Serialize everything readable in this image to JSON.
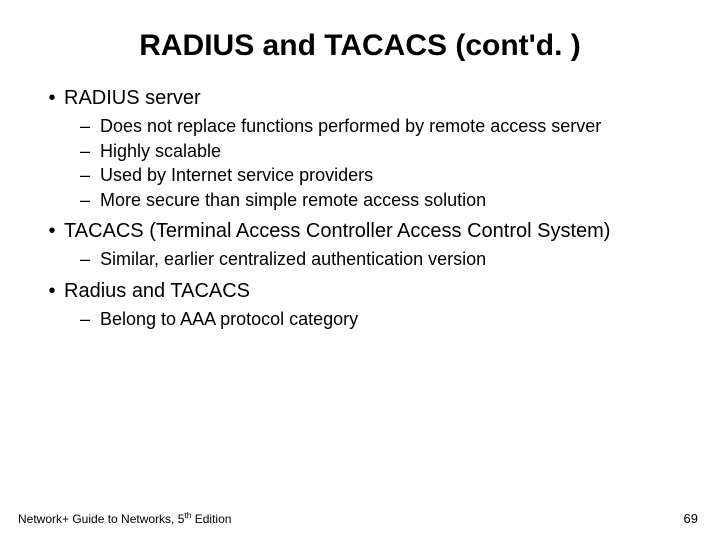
{
  "title": "RADIUS and TACACS (cont'd. )",
  "bullets": [
    {
      "text": "RADIUS server",
      "sub": [
        "Does not replace functions performed by remote access server",
        "Highly scalable",
        "Used by Internet service providers",
        "More secure than simple remote access solution"
      ]
    },
    {
      "text": "TACACS (Terminal Access Controller Access Control System)",
      "sub": [
        "Similar, earlier centralized authentication version"
      ]
    },
    {
      "text": "Radius and TACACS",
      "sub": [
        "Belong to AAA protocol category"
      ]
    }
  ],
  "footer_prefix": "Network+ Guide to Networks, 5",
  "footer_ord": "th",
  "footer_suffix": " Edition",
  "page_number": "69"
}
